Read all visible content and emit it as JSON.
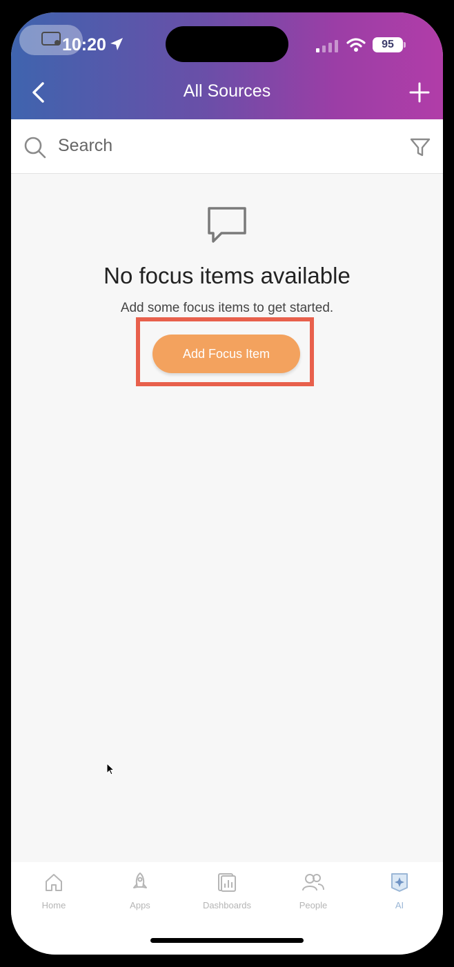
{
  "status_bar": {
    "time": "10:20",
    "battery": "95"
  },
  "header": {
    "title": "All Sources"
  },
  "search": {
    "placeholder": "Search"
  },
  "empty_state": {
    "title": "No focus items available",
    "subtitle": "Add some focus items to get started.",
    "button_label": "Add Focus Item"
  },
  "tabs": [
    {
      "label": "Home",
      "icon": "home-icon"
    },
    {
      "label": "Apps",
      "icon": "rocket-icon"
    },
    {
      "label": "Dashboards",
      "icon": "dashboard-icon"
    },
    {
      "label": "People",
      "icon": "people-icon"
    },
    {
      "label": "AI",
      "icon": "ai-icon"
    }
  ],
  "colors": {
    "header_gradient_start": "#3f64ae",
    "header_gradient_end": "#b13da8",
    "accent_button": "#f3a25e",
    "highlight_box": "#e8604c"
  }
}
